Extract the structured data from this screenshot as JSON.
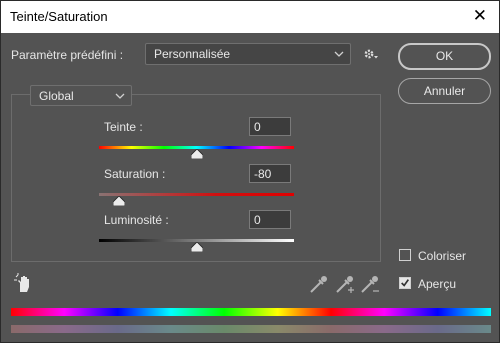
{
  "window": {
    "title": "Teinte/Saturation",
    "close_icon": "close-icon"
  },
  "preset": {
    "label": "Paramètre prédéfini :",
    "value": "Personnalisée",
    "gear_icon": "gear-icon"
  },
  "buttons": {
    "ok": "OK",
    "cancel": "Annuler"
  },
  "channel": {
    "value": "Global"
  },
  "sliders": {
    "hue": {
      "label": "Teinte :",
      "value": "0",
      "level": 0.5
    },
    "saturation": {
      "label": "Saturation :",
      "value": "-80",
      "level": 0.1
    },
    "lightness": {
      "label": "Luminosité :",
      "value": "0",
      "level": 0.5
    }
  },
  "options": {
    "colorize": {
      "label": "Coloriser",
      "checked": false
    },
    "preview": {
      "label": "Aperçu",
      "checked": true
    }
  },
  "tools": [
    "hand-target-icon",
    "eyedropper-icon",
    "eyedropper-plus-icon",
    "eyedropper-minus-icon"
  ],
  "colors": {
    "background": "#535353",
    "field": "#3c3c3c",
    "text": "#e6e6e6"
  }
}
